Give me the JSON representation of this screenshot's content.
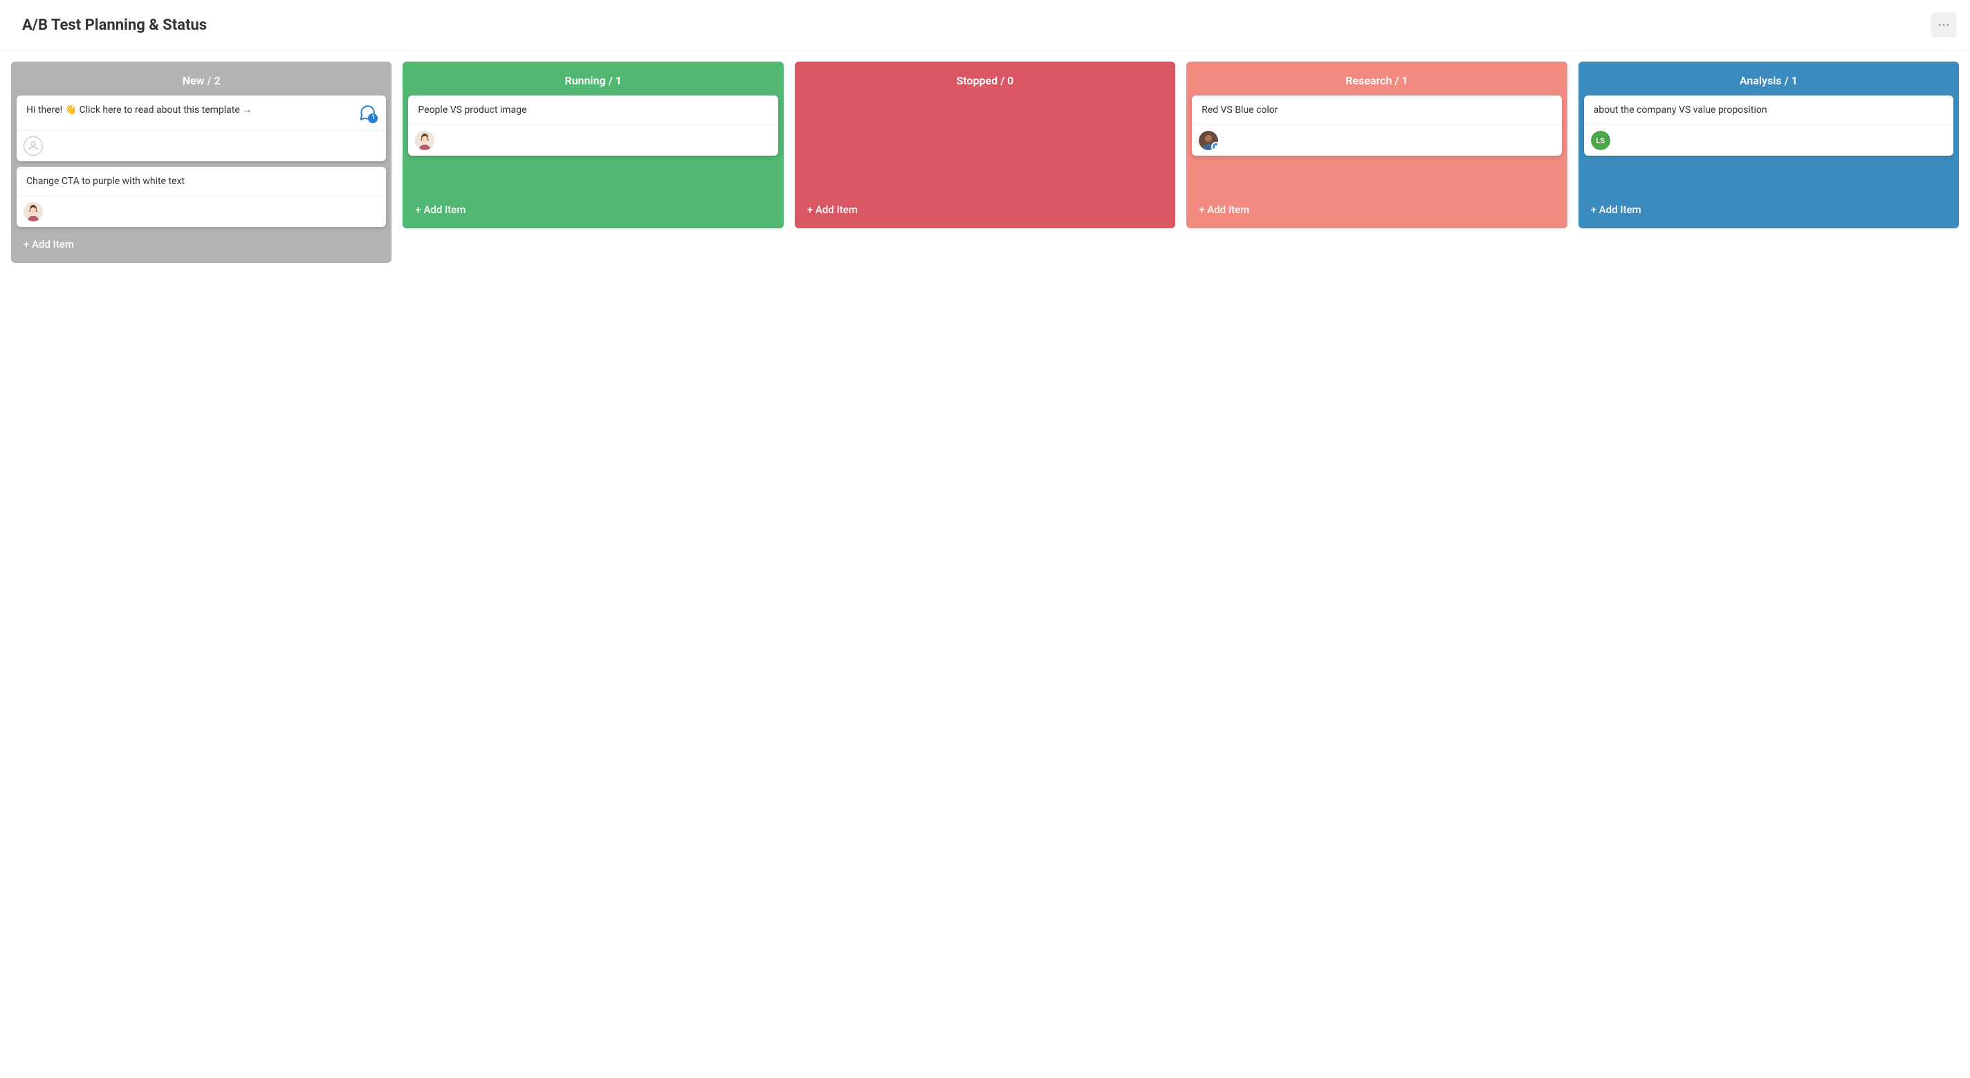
{
  "header": {
    "title": "A/B Test Planning & Status"
  },
  "add_item_label": "+ Add Item",
  "columns": [
    {
      "id": "new",
      "title": "New / 2",
      "color": "#b3b3b3",
      "cards": [
        {
          "text": "Hi there!  👋  Click here to read about this template  →",
          "comment_count": "1",
          "avatar": {
            "type": "placeholder"
          }
        },
        {
          "text": "Change CTA to purple with white text",
          "avatar": {
            "type": "image",
            "name": "assignee-1"
          }
        }
      ]
    },
    {
      "id": "running",
      "title": "Running / 1",
      "color": "#51b874",
      "cards": [
        {
          "text": "People VS product image",
          "avatar": {
            "type": "image",
            "name": "assignee-1"
          }
        }
      ]
    },
    {
      "id": "stopped",
      "title": "Stopped / 0",
      "color": "#d95763",
      "cards": []
    },
    {
      "id": "research",
      "title": "Research / 1",
      "color": "#f28a82",
      "cards": [
        {
          "text": "Red VS Blue color",
          "avatar": {
            "type": "image",
            "name": "assignee-2",
            "badge": true
          }
        }
      ]
    },
    {
      "id": "analysis",
      "title": "Analysis / 1",
      "color": "#3b8bbf",
      "cards": [
        {
          "text": "about the company VS value proposition",
          "avatar": {
            "type": "initials",
            "initials": "LS"
          }
        }
      ]
    }
  ]
}
